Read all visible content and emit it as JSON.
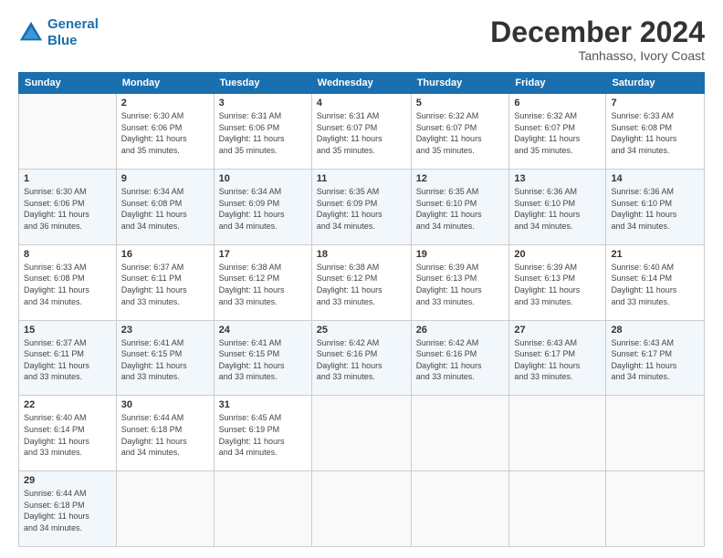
{
  "header": {
    "logo_line1": "General",
    "logo_line2": "Blue",
    "title": "December 2024",
    "subtitle": "Tanhasso, Ivory Coast"
  },
  "calendar": {
    "days_of_week": [
      "Sunday",
      "Monday",
      "Tuesday",
      "Wednesday",
      "Thursday",
      "Friday",
      "Saturday"
    ],
    "weeks": [
      [
        {
          "day": "",
          "info": ""
        },
        {
          "day": "2",
          "info": "Sunrise: 6:30 AM\nSunset: 6:06 PM\nDaylight: 11 hours\nand 35 minutes."
        },
        {
          "day": "3",
          "info": "Sunrise: 6:31 AM\nSunset: 6:06 PM\nDaylight: 11 hours\nand 35 minutes."
        },
        {
          "day": "4",
          "info": "Sunrise: 6:31 AM\nSunset: 6:07 PM\nDaylight: 11 hours\nand 35 minutes."
        },
        {
          "day": "5",
          "info": "Sunrise: 6:32 AM\nSunset: 6:07 PM\nDaylight: 11 hours\nand 35 minutes."
        },
        {
          "day": "6",
          "info": "Sunrise: 6:32 AM\nSunset: 6:07 PM\nDaylight: 11 hours\nand 35 minutes."
        },
        {
          "day": "7",
          "info": "Sunrise: 6:33 AM\nSunset: 6:08 PM\nDaylight: 11 hours\nand 34 minutes."
        }
      ],
      [
        {
          "day": "1",
          "info": "Sunrise: 6:30 AM\nSunset: 6:06 PM\nDaylight: 11 hours\nand 36 minutes."
        },
        {
          "day": "9",
          "info": "Sunrise: 6:34 AM\nSunset: 6:08 PM\nDaylight: 11 hours\nand 34 minutes."
        },
        {
          "day": "10",
          "info": "Sunrise: 6:34 AM\nSunset: 6:09 PM\nDaylight: 11 hours\nand 34 minutes."
        },
        {
          "day": "11",
          "info": "Sunrise: 6:35 AM\nSunset: 6:09 PM\nDaylight: 11 hours\nand 34 minutes."
        },
        {
          "day": "12",
          "info": "Sunrise: 6:35 AM\nSunset: 6:10 PM\nDaylight: 11 hours\nand 34 minutes."
        },
        {
          "day": "13",
          "info": "Sunrise: 6:36 AM\nSunset: 6:10 PM\nDaylight: 11 hours\nand 34 minutes."
        },
        {
          "day": "14",
          "info": "Sunrise: 6:36 AM\nSunset: 6:10 PM\nDaylight: 11 hours\nand 34 minutes."
        }
      ],
      [
        {
          "day": "8",
          "info": "Sunrise: 6:33 AM\nSunset: 6:08 PM\nDaylight: 11 hours\nand 34 minutes."
        },
        {
          "day": "16",
          "info": "Sunrise: 6:37 AM\nSunset: 6:11 PM\nDaylight: 11 hours\nand 33 minutes."
        },
        {
          "day": "17",
          "info": "Sunrise: 6:38 AM\nSunset: 6:12 PM\nDaylight: 11 hours\nand 33 minutes."
        },
        {
          "day": "18",
          "info": "Sunrise: 6:38 AM\nSunset: 6:12 PM\nDaylight: 11 hours\nand 33 minutes."
        },
        {
          "day": "19",
          "info": "Sunrise: 6:39 AM\nSunset: 6:13 PM\nDaylight: 11 hours\nand 33 minutes."
        },
        {
          "day": "20",
          "info": "Sunrise: 6:39 AM\nSunset: 6:13 PM\nDaylight: 11 hours\nand 33 minutes."
        },
        {
          "day": "21",
          "info": "Sunrise: 6:40 AM\nSunset: 6:14 PM\nDaylight: 11 hours\nand 33 minutes."
        }
      ],
      [
        {
          "day": "15",
          "info": "Sunrise: 6:37 AM\nSunset: 6:11 PM\nDaylight: 11 hours\nand 33 minutes."
        },
        {
          "day": "23",
          "info": "Sunrise: 6:41 AM\nSunset: 6:15 PM\nDaylight: 11 hours\nand 33 minutes."
        },
        {
          "day": "24",
          "info": "Sunrise: 6:41 AM\nSunset: 6:15 PM\nDaylight: 11 hours\nand 33 minutes."
        },
        {
          "day": "25",
          "info": "Sunrise: 6:42 AM\nSunset: 6:16 PM\nDaylight: 11 hours\nand 33 minutes."
        },
        {
          "day": "26",
          "info": "Sunrise: 6:42 AM\nSunset: 6:16 PM\nDaylight: 11 hours\nand 33 minutes."
        },
        {
          "day": "27",
          "info": "Sunrise: 6:43 AM\nSunset: 6:17 PM\nDaylight: 11 hours\nand 33 minutes."
        },
        {
          "day": "28",
          "info": "Sunrise: 6:43 AM\nSunset: 6:17 PM\nDaylight: 11 hours\nand 34 minutes."
        }
      ],
      [
        {
          "day": "22",
          "info": "Sunrise: 6:40 AM\nSunset: 6:14 PM\nDaylight: 11 hours\nand 33 minutes."
        },
        {
          "day": "30",
          "info": "Sunrise: 6:44 AM\nSunset: 6:18 PM\nDaylight: 11 hours\nand 34 minutes."
        },
        {
          "day": "31",
          "info": "Sunrise: 6:45 AM\nSunset: 6:19 PM\nDaylight: 11 hours\nand 34 minutes."
        },
        {
          "day": "",
          "info": ""
        },
        {
          "day": "",
          "info": ""
        },
        {
          "day": "",
          "info": ""
        },
        {
          "day": "",
          "info": ""
        }
      ],
      [
        {
          "day": "29",
          "info": "Sunrise: 6:44 AM\nSunset: 6:18 PM\nDaylight: 11 hours\nand 34 minutes."
        },
        {
          "day": "",
          "info": ""
        },
        {
          "day": "",
          "info": ""
        },
        {
          "day": "",
          "info": ""
        },
        {
          "day": "",
          "info": ""
        },
        {
          "day": "",
          "info": ""
        },
        {
          "day": "",
          "info": ""
        }
      ]
    ]
  }
}
